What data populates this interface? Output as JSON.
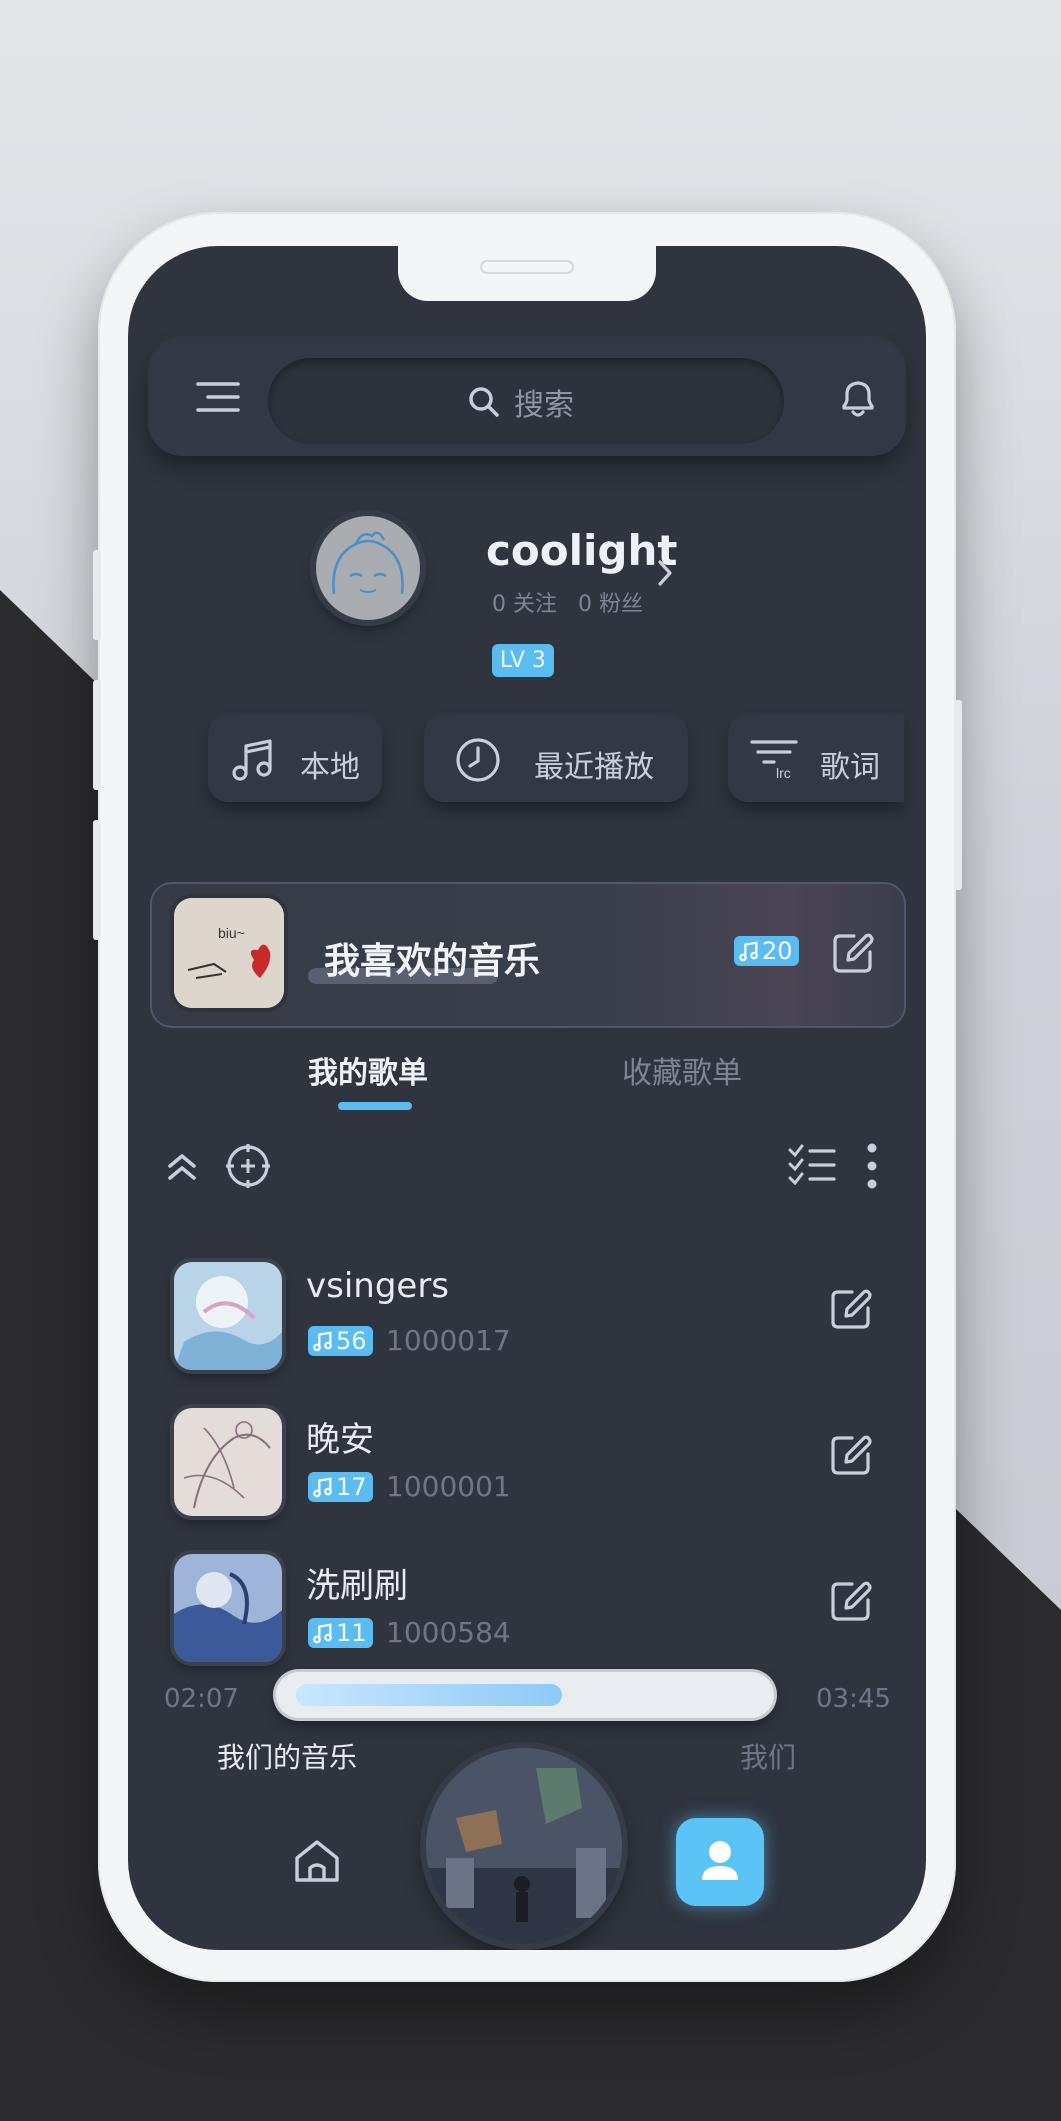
{
  "header": {
    "search_placeholder": "搜索",
    "menu_icon": "menu-icon",
    "bell_icon": "bell-icon"
  },
  "profile": {
    "username": "coolight",
    "following": "0 关注",
    "followers": "0 粉丝",
    "level": "LV 3"
  },
  "quick_actions": [
    {
      "label": "本地",
      "icon": "music-note-icon"
    },
    {
      "label": "最近播放",
      "icon": "clock-icon"
    },
    {
      "label": "歌词",
      "icon": "lyrics-icon"
    }
  ],
  "favorites": {
    "title": "我喜欢的音乐",
    "count": "20",
    "cover_text": "biu~"
  },
  "tabs": [
    {
      "label": "我的歌单",
      "active": true
    },
    {
      "label": "收藏歌单",
      "active": false
    }
  ],
  "playlists": [
    {
      "name": "vsingers",
      "count": "56",
      "id": "1000017"
    },
    {
      "name": "晚安",
      "count": "17",
      "id": "1000001"
    },
    {
      "name": "洗刷刷",
      "count": "11",
      "id": "1000584"
    }
  ],
  "player": {
    "current_time": "02:07",
    "total_time": "03:45",
    "progress": 0.58,
    "current_song": "我们的音乐",
    "next_song": "我们"
  },
  "colors": {
    "accent": "#5bbcf0",
    "screen_bg": "#2f343e"
  }
}
